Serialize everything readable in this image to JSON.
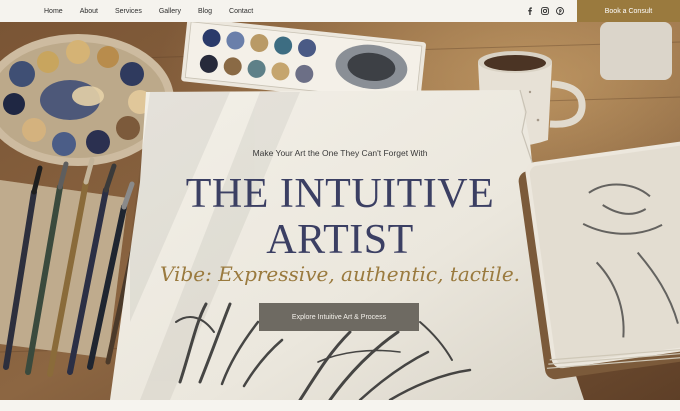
{
  "nav": {
    "links": [
      "Home",
      "About",
      "Services",
      "Gallery",
      "Blog",
      "Contact"
    ],
    "social_icons": [
      "facebook-icon",
      "instagram-icon",
      "pinterest-icon"
    ],
    "consult_label": "Book a Consult"
  },
  "hero": {
    "eyebrow": "Make Your Art the One They Can't Forget With",
    "title_line1": "THE INTUITIVE",
    "title_line2": "ARTIST",
    "tagline": "Vibe: Expressive, authentic, tactile.",
    "cta_label": "Explore Intuitive Art & Process"
  },
  "colors": {
    "accent_gold": "#9a7a3e",
    "title_navy": "#3b3f63",
    "button_gray": "#6e6a62",
    "nav_bg": "#f5f3ee"
  }
}
